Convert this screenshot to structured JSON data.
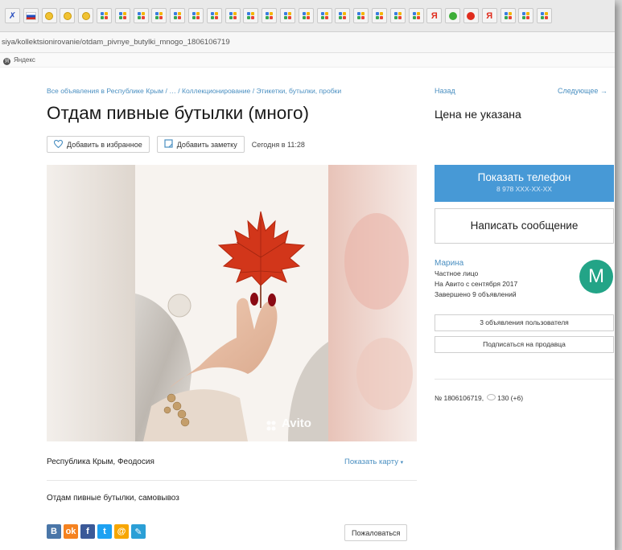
{
  "browser": {
    "tabs": [
      {
        "kind": "glyph",
        "text": "✗",
        "color": "#2a4fbf"
      },
      {
        "kind": "flag"
      },
      {
        "kind": "coin"
      },
      {
        "kind": "coin"
      },
      {
        "kind": "coin"
      },
      {
        "kind": "dots"
      },
      {
        "kind": "dots"
      },
      {
        "kind": "dots"
      },
      {
        "kind": "dots"
      },
      {
        "kind": "dots"
      },
      {
        "kind": "dots"
      },
      {
        "kind": "dots"
      },
      {
        "kind": "dots"
      },
      {
        "kind": "dots"
      },
      {
        "kind": "dots"
      },
      {
        "kind": "dots"
      },
      {
        "kind": "dots"
      },
      {
        "kind": "dots"
      },
      {
        "kind": "dots"
      },
      {
        "kind": "dots"
      },
      {
        "kind": "dots"
      },
      {
        "kind": "dots"
      },
      {
        "kind": "dots"
      },
      {
        "kind": "glyph",
        "text": "Я",
        "color": "#e02d1e"
      },
      {
        "kind": "circle",
        "color": "#3dae38"
      },
      {
        "kind": "circle",
        "color": "#e02d1e"
      },
      {
        "kind": "glyph",
        "text": "Я",
        "color": "#e02d1e"
      },
      {
        "kind": "dots"
      },
      {
        "kind": "dots"
      },
      {
        "kind": "dots"
      }
    ],
    "url": "siya/kollektsionirovanie/otdam_pivnye_butylki_mnogo_1806106719",
    "bookmark_label": "Яндекс"
  },
  "listing": {
    "breadcrumbs": "Все объявления в Республике Крым / … / Коллекционирование / Этикетки, бутылки, пробки",
    "title": "Отдам пивные бутылки (много)",
    "favorite_label": "Добавить в избранное",
    "note_label": "Добавить заметку",
    "date": "Сегодня в 11:28",
    "watermark": "Avito",
    "location": "Республика Крым, Феодосия",
    "show_map": "Показать карту",
    "description": "Отдам пивные бутылки, самовывоз",
    "complain_label": "Пожаловаться",
    "share_icons": [
      {
        "name": "vk-icon",
        "text": "B",
        "color": "#4a76a8"
      },
      {
        "name": "odnoklassniki-icon",
        "text": "ok",
        "color": "#f58220"
      },
      {
        "name": "facebook-icon",
        "text": "f",
        "color": "#3b5998"
      },
      {
        "name": "twitter-icon",
        "text": "t",
        "color": "#1da1f2"
      },
      {
        "name": "mail-icon",
        "text": "@",
        "color": "#f7a600"
      },
      {
        "name": "livejournal-icon",
        "text": "✎",
        "color": "#2b9fd6"
      }
    ]
  },
  "sidebar": {
    "back": "Назад",
    "next": "Следующее →",
    "price": "Цена не указана",
    "phone_title": "Показать телефон",
    "phone_masked": "8 978 XXX-XX-XX",
    "message_label": "Написать сообщение",
    "seller_name": "Марина",
    "seller_type": "Частное лицо",
    "seller_since": "На Авито с сентября 2017",
    "seller_done": "Завершено 9 объявлений",
    "avatar_letter": "М",
    "user_ads": "3 объявления пользователя",
    "subscribe": "Подписаться на продавца",
    "ad_number": "№ 1806106719,",
    "views": "130 (+6)"
  },
  "colors": {
    "link": "#4a8fc1",
    "phone_button": "#4799d6",
    "avatar": "#23a487"
  }
}
